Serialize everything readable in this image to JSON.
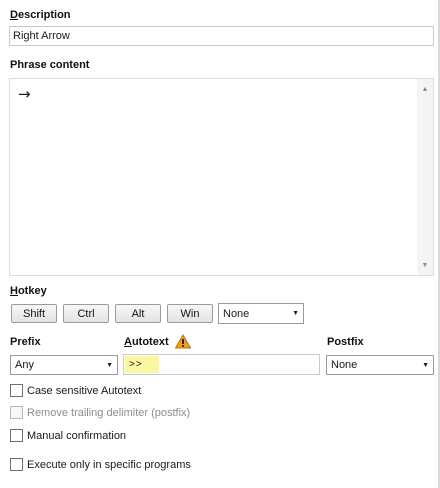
{
  "description": {
    "label_access": "D",
    "label_rest": "escription",
    "value": "Right Arrow"
  },
  "phrase_content": {
    "label": "Phrase content",
    "value": "→"
  },
  "hotkey": {
    "label_access": "H",
    "label_rest": "otkey",
    "shift_label": "Shift",
    "ctrl_label": "Ctrl",
    "alt_label": "Alt",
    "win_label": "Win",
    "key_value": "None"
  },
  "prefix": {
    "label": "Prefix",
    "value": "Any"
  },
  "autotext": {
    "label_access": "A",
    "label_rest": "utotext",
    "value": ">>",
    "warning_icon": "warning-icon"
  },
  "postfix": {
    "label": "Postfix",
    "value": "None"
  },
  "options": {
    "case_sensitive": "Case sensitive Autotext",
    "remove_trailing": "Remove trailing delimiter (postfix)",
    "manual_confirmation": "Manual confirmation",
    "execute_only": "Execute only in specific programs"
  },
  "colors": {
    "autotext_highlight": "#fbf7a0",
    "warning": "#f0a01c"
  }
}
